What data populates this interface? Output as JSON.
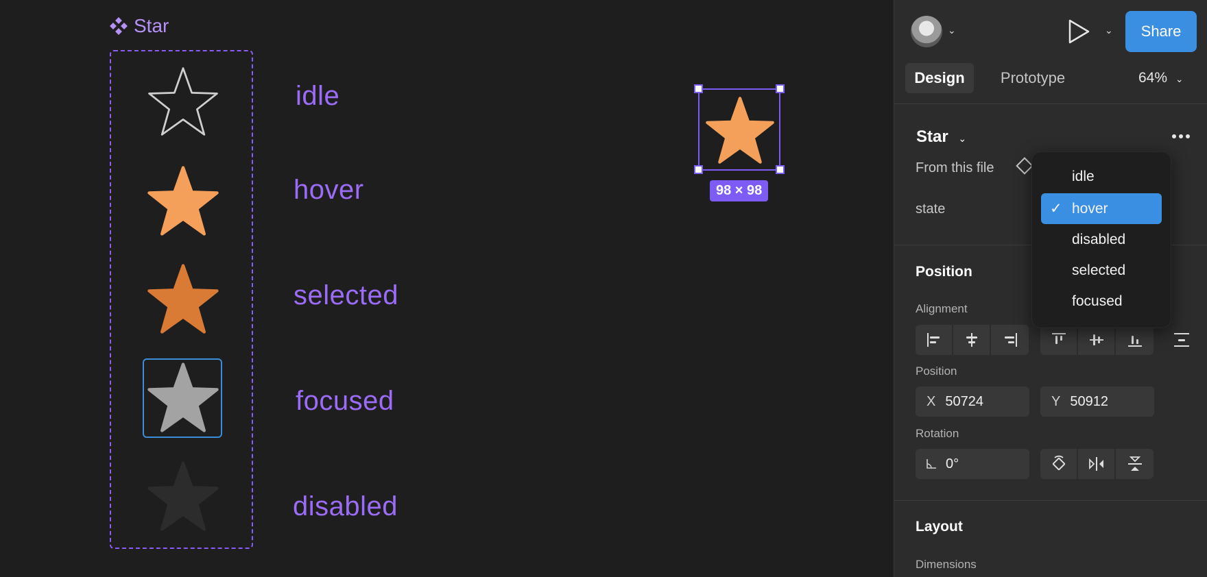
{
  "canvas": {
    "component_title": "Star",
    "states": [
      "idle",
      "hover",
      "disabled",
      "selected",
      "focused"
    ],
    "variant_labels": [
      "idle",
      "hover",
      "selected",
      "focused",
      "disabled"
    ],
    "selection_size": "98 × 98"
  },
  "colors": {
    "accent_purple": "#8b5cf6",
    "star_hover": "#f4a05a",
    "star_selected": "#d97a35",
    "star_focused": "#a3a3a3",
    "star_disabled": "#2c2c2c",
    "share_blue": "#3a8fe2"
  },
  "toolbar": {
    "share_label": "Share"
  },
  "tabs": [
    {
      "label": "Design"
    },
    {
      "label": "Prototype"
    }
  ],
  "zoom": "64%",
  "component": {
    "name": "Star",
    "source": "From this file",
    "property_label": "state"
  },
  "dropdown": {
    "items": [
      "idle",
      "hover",
      "disabled",
      "selected",
      "focused"
    ],
    "selected_index": 1,
    "check": "✓"
  },
  "position": {
    "title": "Position",
    "alignment_label": "Alignment",
    "position_label": "Position",
    "x_prefix": "X",
    "x_value": "50724",
    "y_prefix": "Y",
    "y_value": "50912",
    "rotation_label": "Rotation",
    "rotation_value": "0°"
  },
  "layout": {
    "title": "Layout",
    "dimensions_label": "Dimensions"
  },
  "icons": [
    "component-icon",
    "star-icon",
    "avatar",
    "play-icon",
    "chevron-down-icon",
    "more-icon",
    "diamond-icon",
    "align-left-icon",
    "align-center-h-icon",
    "align-right-icon",
    "align-top-icon",
    "align-middle-icon",
    "align-bottom-icon",
    "distribute-icon",
    "rotate-icon",
    "flip-horizontal-icon",
    "flip-vertical-icon",
    "check-icon"
  ]
}
